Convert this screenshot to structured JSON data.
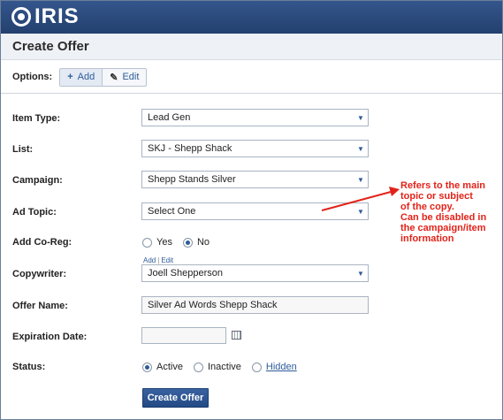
{
  "app": {
    "logo_text": "IRIS"
  },
  "page": {
    "title": "Create Offer"
  },
  "options": {
    "label": "Options:",
    "add_label": "Add",
    "add_icon": "plus-icon",
    "edit_label": "Edit",
    "edit_icon": "pencil-icon"
  },
  "form": {
    "item_type": {
      "label": "Item Type:",
      "value": "Lead Gen"
    },
    "list": {
      "label": "List:",
      "value": "SKJ - Shepp Shack"
    },
    "campaign": {
      "label": "Campaign:",
      "value": "Shepp Stands Silver"
    },
    "ad_topic": {
      "label": "Ad Topic:",
      "value": "Select One"
    },
    "add_coreg": {
      "label": "Add Co-Reg:",
      "options": [
        "Yes",
        "No"
      ],
      "selected": "No"
    },
    "copywriter": {
      "label": "Copywriter:",
      "value": "Joell Shepperson",
      "add_link": "Add",
      "edit_link": "Edit",
      "separator": "|"
    },
    "offer_name": {
      "label": "Offer Name:",
      "value": "Silver Ad Words Shepp Shack"
    },
    "expiration_date": {
      "label": "Expiration Date:",
      "value": "",
      "icon": "calendar-icon"
    },
    "status": {
      "label": "Status:",
      "options": [
        "Active",
        "Inactive",
        "Hidden"
      ],
      "selected": "Active"
    },
    "submit_label": "Create Offer"
  },
  "annotation": {
    "lines": [
      "Refers to the main",
      "topic or subject",
      "of the copy.",
      "Can be disabled in",
      "the campaign/item",
      "information"
    ],
    "color": "#e2231a"
  },
  "colors": {
    "header": "#2c4a7a",
    "link": "#2d5b99",
    "annotation": "#e2231a"
  }
}
